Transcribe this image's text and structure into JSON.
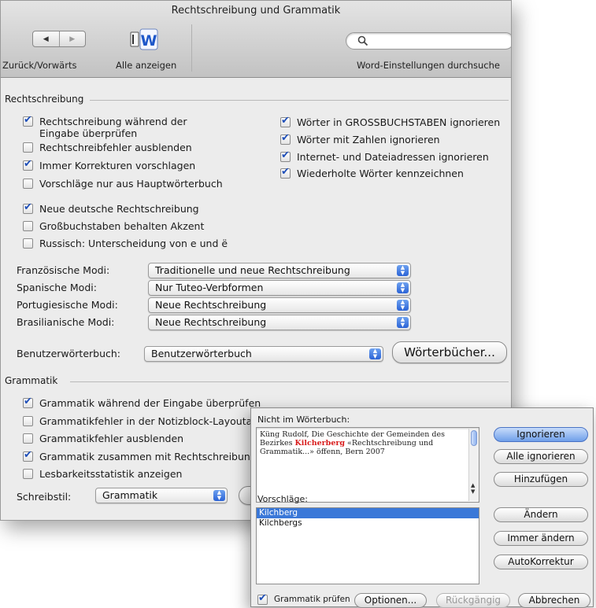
{
  "window": {
    "title": "Rechtschreibung und Grammatik",
    "toolbar": {
      "back_forward_label": "Zurück/Vorwärts",
      "show_all_label": "Alle anzeigen",
      "search_placeholder": "",
      "search_label": "Word-Einstellungen durchsuche"
    }
  },
  "spelling": {
    "group_label": "Rechtschreibung",
    "left_options": [
      {
        "label": "Rechtschreibung während der Eingabe überprüfen",
        "checked": true
      },
      {
        "label": "Rechtschreibfehler ausblenden",
        "checked": false
      },
      {
        "label": "Immer Korrekturen vorschlagen",
        "checked": true
      },
      {
        "label": "Vorschläge nur aus Hauptwörterbuch",
        "checked": false
      }
    ],
    "right_options": [
      {
        "label": "Wörter in GROSSBUCHSTABEN ignorieren",
        "checked": true
      },
      {
        "label": "Wörter mit Zahlen ignorieren",
        "checked": true
      },
      {
        "label": "Internet- und Dateiadressen ignorieren",
        "checked": true
      },
      {
        "label": "Wiederholte Wörter kennzeichnen",
        "checked": true
      }
    ],
    "extra_options": [
      {
        "label": "Neue deutsche Rechtschreibung",
        "checked": true
      },
      {
        "label": "Großbuchstaben behalten Akzent",
        "checked": false
      },
      {
        "label": "Russisch: Unterscheidung von e und ë",
        "checked": false
      }
    ],
    "modes": [
      {
        "label": "Französische Modi:",
        "value": "Traditionelle und neue Rechtschreibung"
      },
      {
        "label": "Spanische Modi:",
        "value": "Nur Tuteo-Verbformen"
      },
      {
        "label": "Portugiesische Modi:",
        "value": "Neue Rechtschreibung"
      },
      {
        "label": "Brasilianische Modi:",
        "value": "Neue Rechtschreibung"
      }
    ],
    "user_dictionary_label": "Benutzerwörterbuch:",
    "user_dictionary_value": "Benutzerwörterbuch",
    "dictionaries_button": "Wörterbücher..."
  },
  "grammar": {
    "group_label": "Grammatik",
    "options": [
      {
        "label": "Grammatik während der Eingabe überprüfen",
        "checked": true
      },
      {
        "label": "Grammatikfehler in der Notizblock-Layoutansicht",
        "checked": false
      },
      {
        "label": "Grammatikfehler ausblenden",
        "checked": false
      },
      {
        "label": "Grammatik zusammen mit Rechtschreibung prüfen",
        "checked": true
      },
      {
        "label": "Lesbarkeitsstatistik anzeigen",
        "checked": false
      }
    ],
    "style_label": "Schreibstil:",
    "style_value": "Grammatik"
  },
  "dialog": {
    "not_in_dictionary_label": "Nicht im Wörterbuch:",
    "context_before": "Küng Rudolf, Die Geschichte der Gemeinden des Bezirkes ",
    "error_word": "Kilcherberg",
    "context_after": " «Rechtschreibung und Grammatik...» öffenn, Bern 2007",
    "suggestions_label": "Vorschläge:",
    "suggestions": [
      "Kilchberg",
      "Kilchbergs"
    ],
    "buttons": {
      "ignore": "Ignorieren",
      "ignore_all": "Alle ignorieren",
      "add": "Hinzufügen",
      "change": "Ändern",
      "change_all": "Immer ändern",
      "autocorrect": "AutoKorrektur",
      "options": "Optionen...",
      "undo": "Rückgängig",
      "cancel": "Abbrechen"
    },
    "check_grammar_label": "Grammatik prüfen",
    "check_grammar_checked": true,
    "accent_color": "#3a78d8",
    "error_color": "#d81b1b"
  }
}
